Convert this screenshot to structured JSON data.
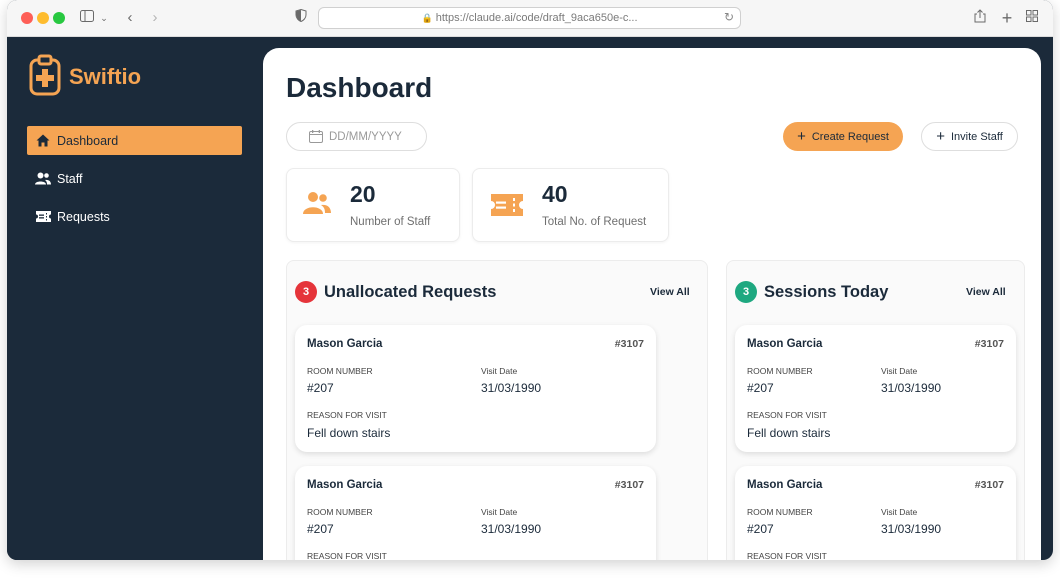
{
  "browser": {
    "url": "https://claude.ai/code/draft_9aca650e-c..."
  },
  "brand": {
    "name": "Swiftio"
  },
  "colors": {
    "accent": "#f5a453",
    "sidebar": "#1b2a3a",
    "badge_red": "#e5343a",
    "badge_green": "#1ea880"
  },
  "sidebar": {
    "items": [
      {
        "label": "Dashboard",
        "icon": "home-icon",
        "active": true
      },
      {
        "label": "Staff",
        "icon": "users-icon",
        "active": false
      },
      {
        "label": "Requests",
        "icon": "ticket-icon",
        "active": false
      }
    ]
  },
  "main": {
    "title": "Dashboard",
    "date_placeholder": "DD/MM/YYYY",
    "create_label": "Create Request",
    "invite_label": "Invite Staff",
    "stats": [
      {
        "value": "20",
        "label": "Number of Staff",
        "icon": "users-icon"
      },
      {
        "value": "40",
        "label": "Total No. of Request",
        "icon": "ticket-icon"
      }
    ],
    "unallocated": {
      "count": "3",
      "title": "Unallocated Requests",
      "view_all": "View All",
      "cards": [
        {
          "name": "Mason Garcia",
          "id": "#3107",
          "room_label": "ROOM NUMBER",
          "room": "#207",
          "date_label": "Visit Date",
          "date": "31/03/1990",
          "reason_label": "REASON FOR VISIT",
          "reason": "Fell down stairs"
        },
        {
          "name": "Mason Garcia",
          "id": "#3107",
          "room_label": "ROOM NUMBER",
          "room": "#207",
          "date_label": "Visit Date",
          "date": "31/03/1990",
          "reason_label": "REASON FOR VISIT",
          "reason": ""
        }
      ]
    },
    "sessions": {
      "count": "3",
      "title": "Sessions Today",
      "view_all": "View All",
      "cards": [
        {
          "name": "Mason Garcia",
          "id": "#3107",
          "room_label": "ROOM NUMBER",
          "room": "#207",
          "date_label": "Visit Date",
          "date": "31/03/1990",
          "reason_label": "REASON FOR VISIT",
          "reason": "Fell down stairs"
        },
        {
          "name": "Mason Garcia",
          "id": "#3107",
          "room_label": "ROOM NUMBER",
          "room": "#207",
          "date_label": "Visit Date",
          "date": "31/03/1990",
          "reason_label": "REASON FOR VISIT",
          "reason": ""
        }
      ]
    }
  }
}
